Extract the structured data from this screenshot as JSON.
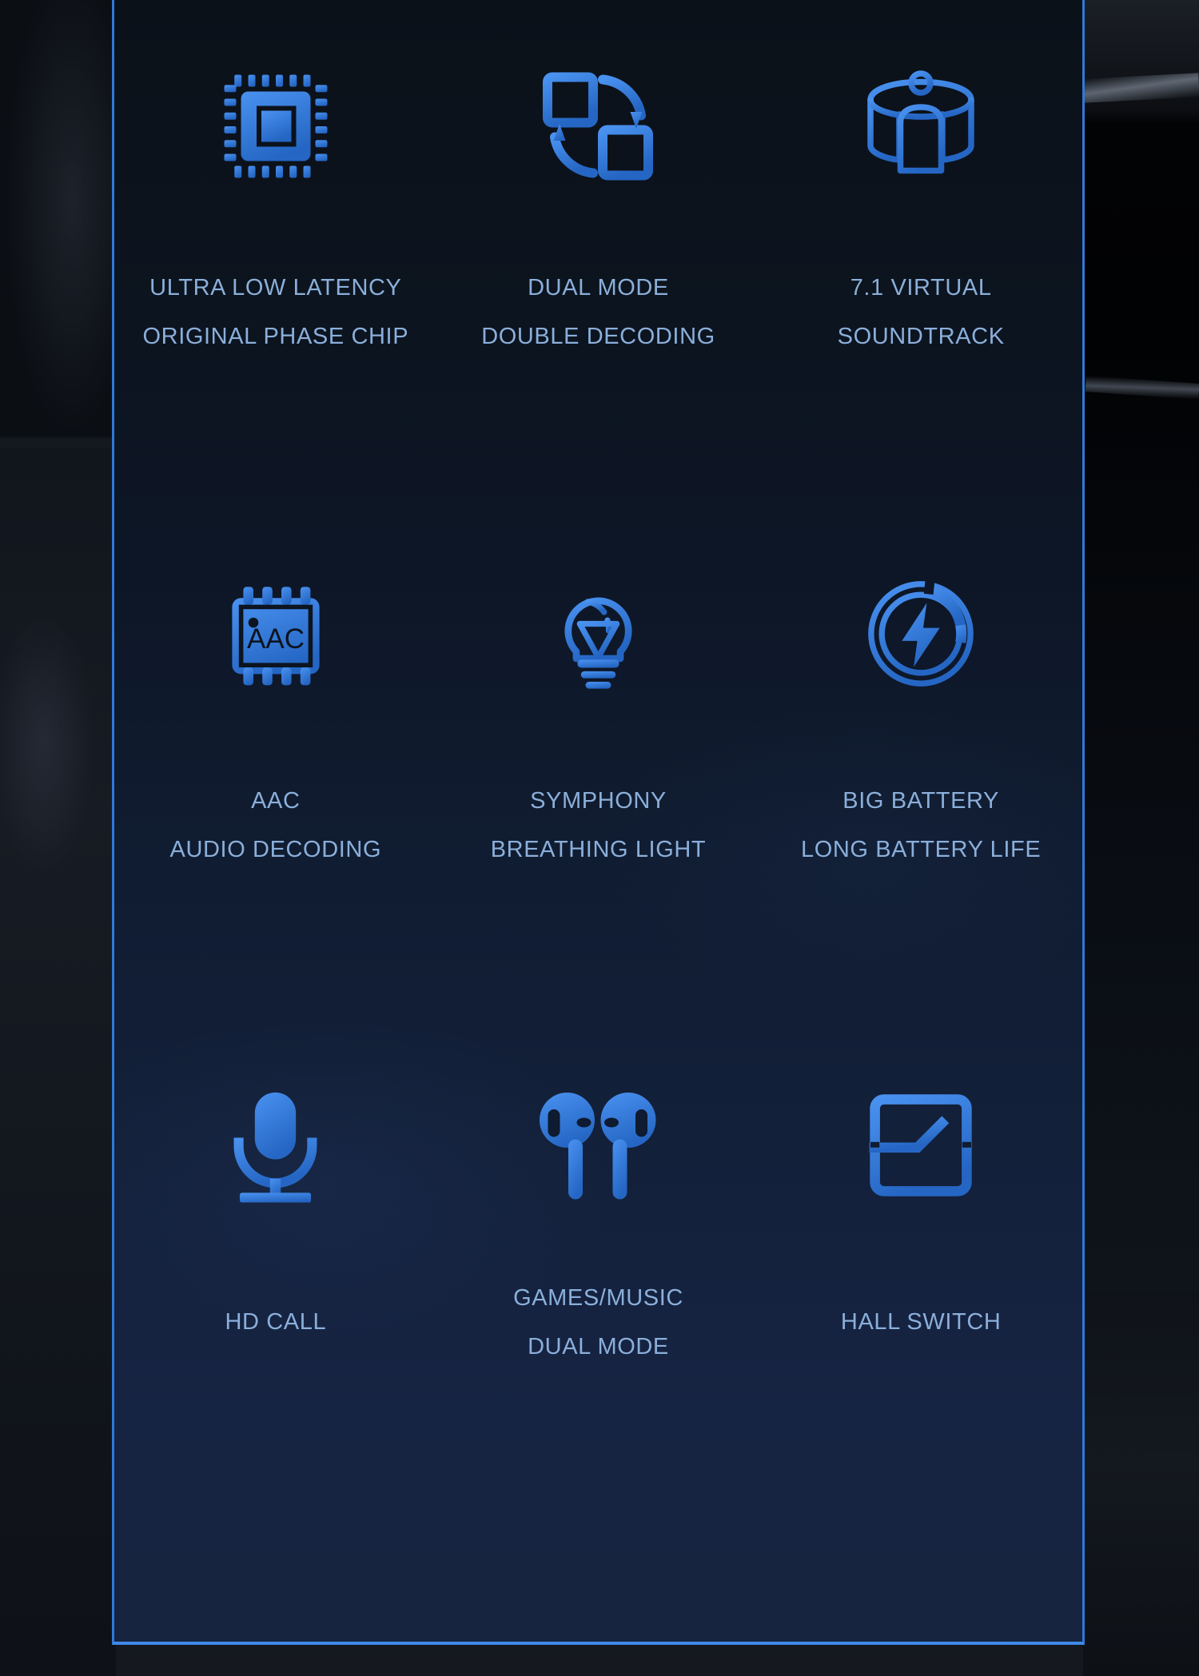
{
  "panel": {
    "border_color": "#2f79d8",
    "bottom_border_color": "#3f8ae8",
    "background_top": "#0b1119",
    "background_bottom": "#16243f",
    "icon_color": "#3b82e8",
    "label_color": "#8bafda"
  },
  "features": [
    {
      "icon": "cpu-chip-icon",
      "line1": "ULTRA LOW LATENCY",
      "line2": "ORIGINAL PHASE CHIP"
    },
    {
      "icon": "dual-mode-swap-icon",
      "line1": "DUAL MODE",
      "line2": "DOUBLE DECODING"
    },
    {
      "icon": "surround-sound-person-icon",
      "line1": "7.1 VIRTUAL",
      "line2": "SOUNDTRACK"
    },
    {
      "icon": "aac-chip-icon",
      "line1": "AAC",
      "line2": "AUDIO DECODING"
    },
    {
      "icon": "light-bulb-icon",
      "line1": "SYMPHONY",
      "line2": "BREATHING LIGHT"
    },
    {
      "icon": "battery-charge-ring-icon",
      "line1": "BIG BATTERY",
      "line2": "LONG BATTERY LIFE"
    },
    {
      "icon": "microphone-icon",
      "line1": "HD CALL",
      "line2": ""
    },
    {
      "icon": "earbuds-pair-icon",
      "line1": "GAMES/MUSIC",
      "line2": "DUAL MODE"
    },
    {
      "icon": "hall-switch-icon",
      "line1": "HALL SWITCH",
      "line2": ""
    }
  ]
}
